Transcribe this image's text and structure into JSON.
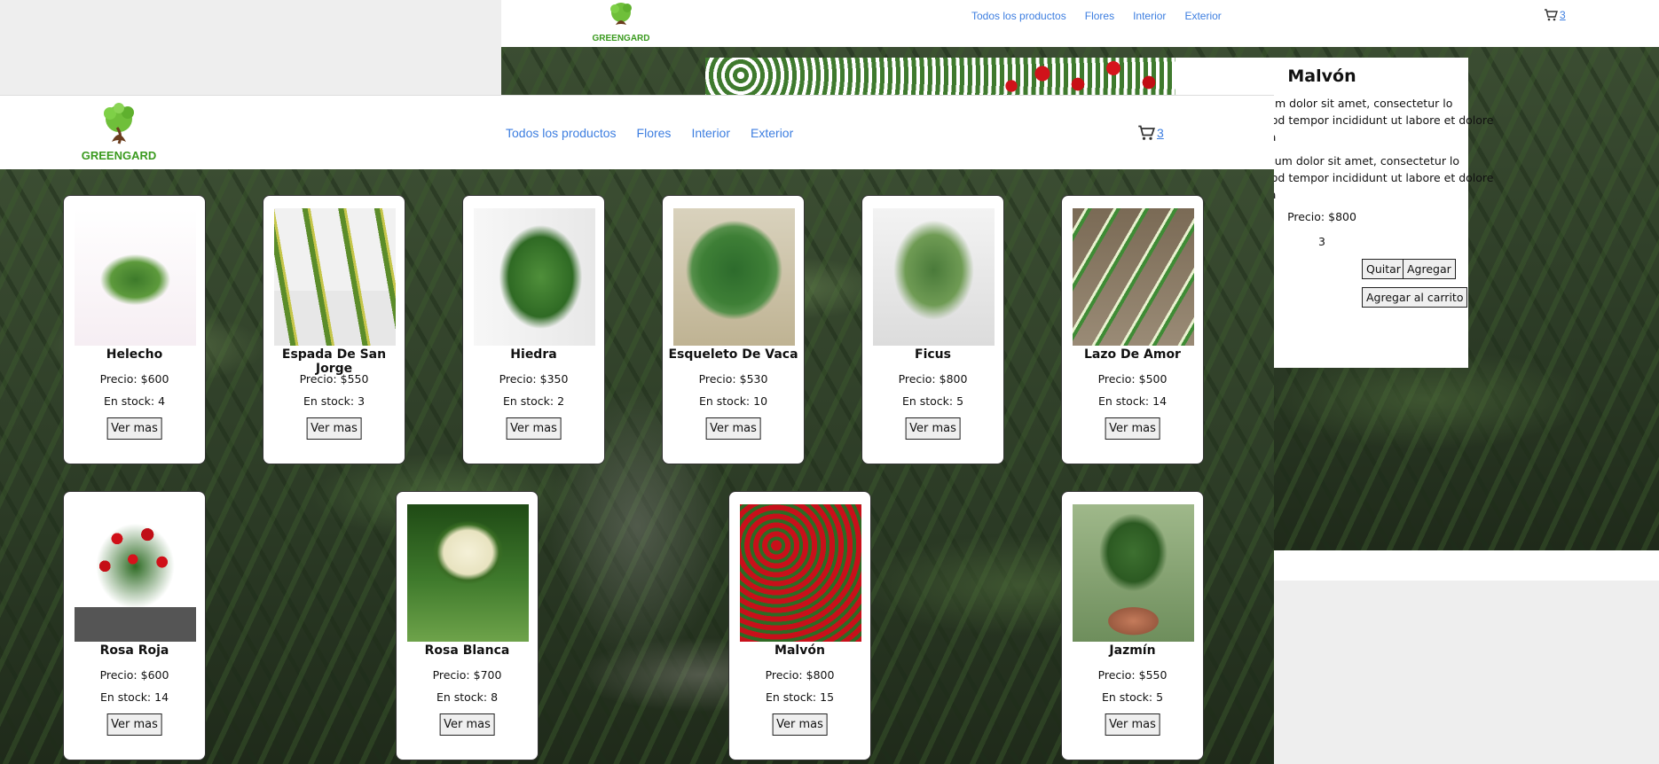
{
  "brand": "GREENGARD",
  "nav": {
    "items": [
      "Todos los productos",
      "Flores",
      "Interior",
      "Exterior"
    ]
  },
  "cart": {
    "count": "3"
  },
  "detail": {
    "title": "Malvón",
    "description_1": "m ipsum dolor sit amet, consectetur lo eiusmod tempor incididunt ut labore et dolore magna",
    "description_2": "em ipsum dolor sit amet, consectetur lo eiusmod tempor incididunt ut labore et dolore magna",
    "price": "Precio: $800",
    "quantity": "3",
    "btn_remove": "Quitar",
    "btn_add": "Agregar",
    "btn_add_cart": "Agregar al carrito"
  },
  "products": [
    {
      "name": "Helecho",
      "price": "Precio: $600",
      "stock": "En stock: 4",
      "button": "Ver mas",
      "image": "fern"
    },
    {
      "name": "Espada De San Jorge",
      "price": "Precio: $550",
      "stock": "En stock: 3",
      "button": "Ver mas",
      "image": "snake-plant"
    },
    {
      "name": "Hiedra",
      "price": "Precio: $350",
      "stock": "En stock: 2",
      "button": "Ver mas",
      "image": "ivy"
    },
    {
      "name": "Esqueleto De Vaca",
      "price": "Precio: $530",
      "stock": "En stock: 10",
      "button": "Ver mas",
      "image": "monstera"
    },
    {
      "name": "Ficus",
      "price": "Precio: $800",
      "stock": "En stock: 5",
      "button": "Ver mas",
      "image": "ficus"
    },
    {
      "name": "Lazo De Amor",
      "price": "Precio: $500",
      "stock": "En stock: 14",
      "button": "Ver mas",
      "image": "spider-plant"
    },
    {
      "name": "Rosa Roja",
      "price": "Precio: $600",
      "stock": "En stock: 14",
      "button": "Ver mas",
      "image": "red-rose"
    },
    {
      "name": "Rosa Blanca",
      "price": "Precio: $700",
      "stock": "En stock: 8",
      "button": "Ver mas",
      "image": "white-rose"
    },
    {
      "name": "Malvón",
      "price": "Precio: $800",
      "stock": "En stock: 15",
      "button": "Ver mas",
      "image": "geranium"
    },
    {
      "name": "Jazmín",
      "price": "Precio: $550",
      "stock": "En stock: 5",
      "button": "Ver mas",
      "image": "jasmine"
    }
  ],
  "colors": {
    "link": "#3d7ee0",
    "brand_green": "#3a9a1e",
    "brand_brown": "#6b3d1e"
  }
}
